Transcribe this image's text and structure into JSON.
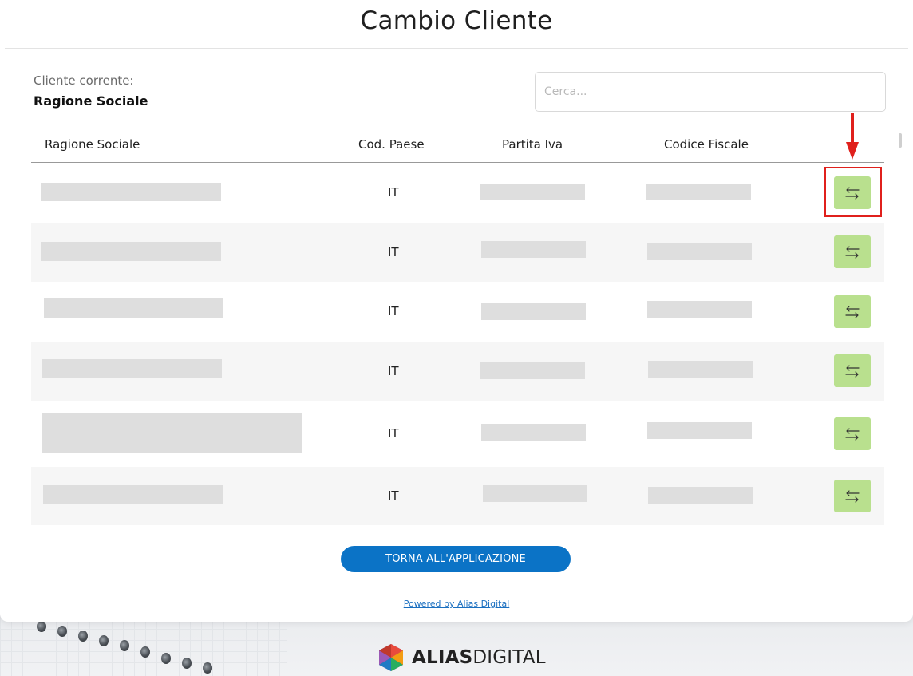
{
  "page": {
    "title": "Cambio Cliente"
  },
  "current_client": {
    "label": "Cliente corrente:",
    "value": "Ragione Sociale"
  },
  "search": {
    "placeholder": "Cerca..."
  },
  "table": {
    "columns": [
      "Ragione Sociale",
      "Cod. Paese",
      "Partita Iva",
      "Codice Fiscale"
    ],
    "rows": [
      {
        "cod_paese": "IT"
      },
      {
        "cod_paese": "IT"
      },
      {
        "cod_paese": "IT"
      },
      {
        "cod_paese": "IT"
      },
      {
        "cod_paese": "IT"
      },
      {
        "cod_paese": "IT"
      }
    ],
    "action_icon": "switch-arrows-icon"
  },
  "footer": {
    "back_label": "TORNA ALL'APPLICAZIONE",
    "powered_label": "Powered by Alias Digital"
  },
  "brand": {
    "name_bold": "ALIAS",
    "name_light": "DIGITAL"
  },
  "colors": {
    "primary": "#0b73c6",
    "action": "#b9e08e",
    "highlight": "#e0201c",
    "row_alt": "#f6f6f6"
  }
}
